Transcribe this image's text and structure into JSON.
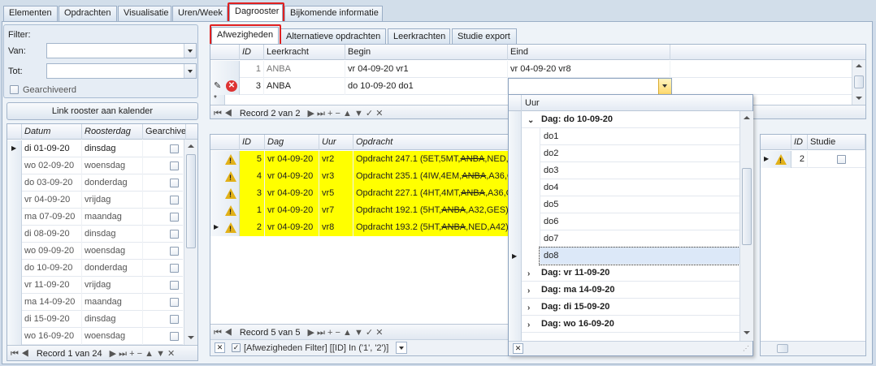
{
  "main_tabs": [
    {
      "label": "Elementen"
    },
    {
      "label": "Opdrachten"
    },
    {
      "label": "Visualisatie"
    },
    {
      "label": "Uren/Week"
    },
    {
      "label": "Dagrooster"
    },
    {
      "label": "Bijkomende informatie"
    }
  ],
  "filter": {
    "title": "Filter:",
    "van_label": "Van:",
    "van_value": "",
    "tot_label": "Tot:",
    "tot_value": "",
    "archived_label": "Gearchiveerd",
    "link_button": "Link rooster aan kalender"
  },
  "dates_grid": {
    "headers": [
      "Datum",
      "Roosterdag",
      "Gearchiveerd"
    ],
    "rows": [
      {
        "datum": "di 01-09-20",
        "dag": "dinsdag"
      },
      {
        "datum": "wo 02-09-20",
        "dag": "woensdag"
      },
      {
        "datum": "do 03-09-20",
        "dag": "donderdag"
      },
      {
        "datum": "vr 04-09-20",
        "dag": "vrijdag"
      },
      {
        "datum": "ma 07-09-20",
        "dag": "maandag"
      },
      {
        "datum": "di 08-09-20",
        "dag": "dinsdag"
      },
      {
        "datum": "wo 09-09-20",
        "dag": "woensdag"
      },
      {
        "datum": "do 10-09-20",
        "dag": "donderdag"
      },
      {
        "datum": "vr 11-09-20",
        "dag": "vrijdag"
      },
      {
        "datum": "ma 14-09-20",
        "dag": "maandag"
      },
      {
        "datum": "di 15-09-20",
        "dag": "dinsdag"
      },
      {
        "datum": "wo 16-09-20",
        "dag": "woensdag"
      }
    ],
    "record_text": "Record 1 van 24"
  },
  "sub_tabs": [
    {
      "label": "Afwezigheden"
    },
    {
      "label": "Alternatieve opdrachten"
    },
    {
      "label": "Leerkrachten"
    },
    {
      "label": "Studie export"
    }
  ],
  "absence_grid": {
    "headers": [
      "ID",
      "Leerkracht",
      "Begin",
      "Eind"
    ],
    "rows": [
      {
        "id": "1",
        "leerkracht": "ANBA",
        "begin": "vr 04-09-20 vr1",
        "eind": "vr 04-09-20 vr8"
      },
      {
        "id": "3",
        "leerkracht": "ANBA",
        "begin": "do 10-09-20 do1",
        "eind": ""
      }
    ],
    "record_text": "Record 2 van 2"
  },
  "assign_grid": {
    "headers": [
      "ID",
      "Dag",
      "Uur",
      "Opdracht"
    ],
    "rows": [
      {
        "id": "5",
        "dag": "vr 04-09-20",
        "uur": "vr2",
        "pre": "Opdracht 247.1 (5ET,5MT,",
        "strike": "ANBA",
        "post": ",NED,C"
      },
      {
        "id": "4",
        "dag": "vr 04-09-20",
        "uur": "vr3",
        "pre": "Opdracht 235.1 (4IW,4EM,",
        "strike": "ANBA",
        "post": ",A36,C"
      },
      {
        "id": "3",
        "dag": "vr 04-09-20",
        "uur": "vr5",
        "pre": "Opdracht 227.1 (4HT,4MT,",
        "strike": "ANBA",
        "post": ",A36,C"
      },
      {
        "id": "1",
        "dag": "vr 04-09-20",
        "uur": "vr7",
        "pre": "Opdracht 192.1 (5HT,",
        "strike": "ANBA",
        "post": ",A32,GES)"
      },
      {
        "id": "2",
        "dag": "vr 04-09-20",
        "uur": "vr8",
        "pre": "Opdracht 193.2 (5HT,",
        "strike": "ANBA",
        "post": ",NED,A42)"
      }
    ],
    "record_text": "Record 5 van 5",
    "filter_text": "[Afwezigheden Filter] [[ID] In ('1', '2')]"
  },
  "study_grid": {
    "headers": [
      "ID",
      "Studie"
    ],
    "rows": [
      {
        "id": "2"
      }
    ]
  },
  "dropdown": {
    "header": "Uur",
    "groups": [
      {
        "label": "Dag: do 10-09-20",
        "items": [
          "do1",
          "do2",
          "do3",
          "do4",
          "do5",
          "do6",
          "do7",
          "do8"
        ]
      },
      {
        "label": "Dag: vr 11-09-20"
      },
      {
        "label": "Dag: ma 14-09-20"
      },
      {
        "label": "Dag: di 15-09-20"
      },
      {
        "label": "Dag: wo 16-09-20"
      }
    ],
    "selected": "do8"
  },
  "colors": {
    "highlight_red": "#e02020",
    "row_yellow": "#ffff00",
    "selected_blue": "#dce8f8"
  }
}
